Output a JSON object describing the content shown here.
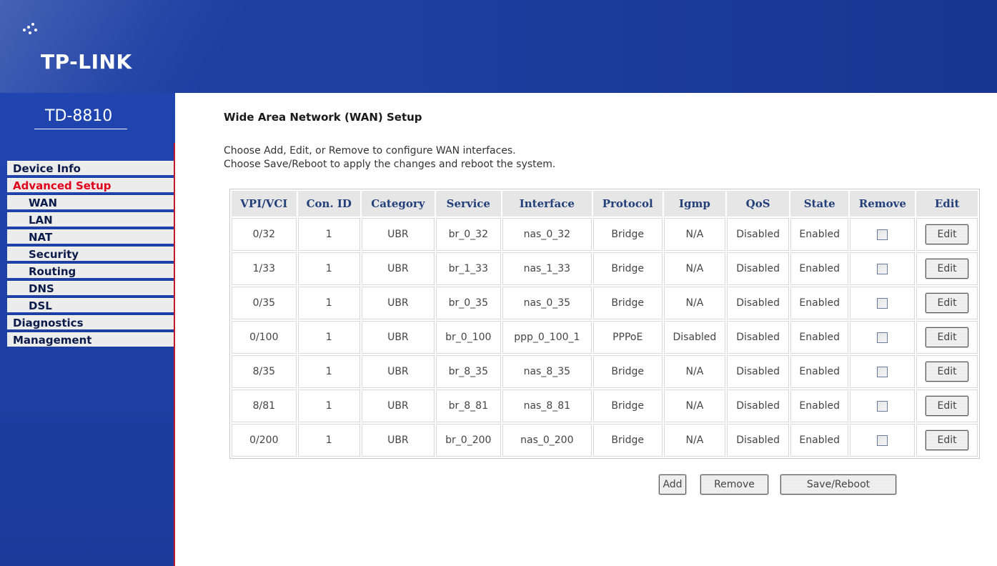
{
  "brand": {
    "logo": "TP-LINK",
    "model": "TD-8810"
  },
  "sidebar": {
    "items": [
      {
        "label": "Device Info",
        "level": 0,
        "active": false
      },
      {
        "label": "Advanced Setup",
        "level": 0,
        "active": true
      },
      {
        "label": "WAN",
        "level": 1,
        "active": false
      },
      {
        "label": "LAN",
        "level": 1,
        "active": false
      },
      {
        "label": "NAT",
        "level": 1,
        "active": false
      },
      {
        "label": "Security",
        "level": 1,
        "active": false
      },
      {
        "label": "Routing",
        "level": 1,
        "active": false
      },
      {
        "label": "DNS",
        "level": 1,
        "active": false
      },
      {
        "label": "DSL",
        "level": 1,
        "active": false
      },
      {
        "label": "Diagnostics",
        "level": 0,
        "active": false
      },
      {
        "label": "Management",
        "level": 0,
        "active": false
      }
    ]
  },
  "main": {
    "title": "Wide Area Network (WAN) Setup",
    "description_line1": "Choose Add, Edit, or Remove to configure WAN interfaces.",
    "description_line2": "Choose Save/Reboot to apply the changes and reboot the system.",
    "table": {
      "headers": [
        "VPI/VCI",
        "Con. ID",
        "Category",
        "Service",
        "Interface",
        "Protocol",
        "Igmp",
        "QoS",
        "State",
        "Remove",
        "Edit"
      ],
      "rows": [
        {
          "vpi_vci": "0/32",
          "con_id": "1",
          "category": "UBR",
          "service": "br_0_32",
          "interface": "nas_0_32",
          "protocol": "Bridge",
          "igmp": "N/A",
          "qos": "Disabled",
          "state": "Enabled",
          "edit_label": "Edit"
        },
        {
          "vpi_vci": "1/33",
          "con_id": "1",
          "category": "UBR",
          "service": "br_1_33",
          "interface": "nas_1_33",
          "protocol": "Bridge",
          "igmp": "N/A",
          "qos": "Disabled",
          "state": "Enabled",
          "edit_label": "Edit"
        },
        {
          "vpi_vci": "0/35",
          "con_id": "1",
          "category": "UBR",
          "service": "br_0_35",
          "interface": "nas_0_35",
          "protocol": "Bridge",
          "igmp": "N/A",
          "qos": "Disabled",
          "state": "Enabled",
          "edit_label": "Edit"
        },
        {
          "vpi_vci": "0/100",
          "con_id": "1",
          "category": "UBR",
          "service": "br_0_100",
          "interface": "ppp_0_100_1",
          "protocol": "PPPoE",
          "igmp": "Disabled",
          "qos": "Disabled",
          "state": "Enabled",
          "edit_label": "Edit"
        },
        {
          "vpi_vci": "8/35",
          "con_id": "1",
          "category": "UBR",
          "service": "br_8_35",
          "interface": "nas_8_35",
          "protocol": "Bridge",
          "igmp": "N/A",
          "qos": "Disabled",
          "state": "Enabled",
          "edit_label": "Edit"
        },
        {
          "vpi_vci": "8/81",
          "con_id": "1",
          "category": "UBR",
          "service": "br_8_81",
          "interface": "nas_8_81",
          "protocol": "Bridge",
          "igmp": "N/A",
          "qos": "Disabled",
          "state": "Enabled",
          "edit_label": "Edit"
        },
        {
          "vpi_vci": "0/200",
          "con_id": "1",
          "category": "UBR",
          "service": "br_0_200",
          "interface": "nas_0_200",
          "protocol": "Bridge",
          "igmp": "N/A",
          "qos": "Disabled",
          "state": "Enabled",
          "edit_label": "Edit"
        }
      ]
    },
    "buttons": {
      "add": "Add",
      "remove": "Remove",
      "save_reboot": "Save/Reboot"
    }
  },
  "colors": {
    "header_blue": "#1d3fa5",
    "active_nav": "#e0001b",
    "sidebar_edge": "#c0182f"
  }
}
